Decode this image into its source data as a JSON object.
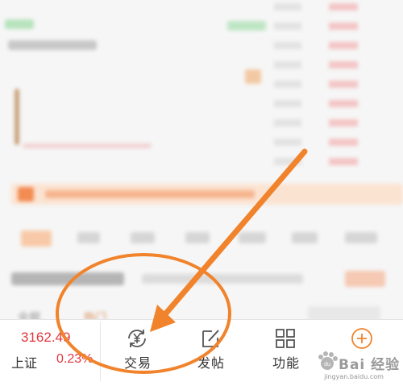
{
  "bottom_bar": {
    "index_value": "3162.49",
    "index_name": "上证",
    "index_change": "0.23%",
    "nav": [
      {
        "label": "交易",
        "icon": "yen-refresh-icon"
      },
      {
        "label": "发帖",
        "icon": "edit-post-icon"
      },
      {
        "label": "功能",
        "icon": "grid-apps-icon"
      },
      {
        "label": "",
        "icon": "plus-circle-icon"
      }
    ]
  },
  "background_tabs": [
    "全部",
    "热门"
  ],
  "colors": {
    "accent_red": "#e2383e",
    "annotation_orange": "#f0832b",
    "up_green": "#2aa84a"
  },
  "watermark": {
    "text": "Bai 经验",
    "badge": "du",
    "url": "jingyan.baidu.com"
  }
}
